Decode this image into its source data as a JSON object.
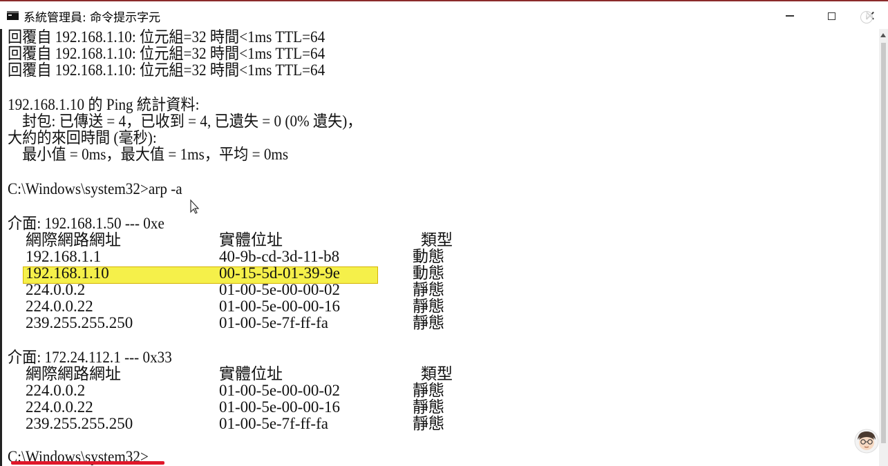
{
  "window": {
    "title": "系統管理員: 命令提示字元",
    "info_badge": "i"
  },
  "console": {
    "lines": [
      "回覆自 192.168.1.10: 位元組=32 時間<1ms TTL=64",
      "回覆自 192.168.1.10: 位元組=32 時間<1ms TTL=64",
      "回覆自 192.168.1.10: 位元組=32 時間<1ms TTL=64",
      "",
      "192.168.1.10 的 Ping 統計資料:",
      "    封包: 已傳送 = 4，已收到 = 4, 已遺失 = 0 (0% 遺失)，",
      "大約的來回時間 (毫秒):",
      "    最小值 = 0ms，最大值 = 1ms，平均 = 0ms",
      "",
      "C:\\Windows\\system32>arp -a"
    ],
    "final_prompt": "C:\\Windows\\system32>"
  },
  "arp": {
    "interfaces": [
      {
        "header": "介面: 192.168.1.50 --- 0xe",
        "columns": {
          "address": "網際網路網址",
          "physical": "實體位址",
          "type": "類型"
        },
        "rows": [
          {
            "address": "192.168.1.1",
            "physical": "40-9b-cd-3d-11-b8",
            "type": "動態",
            "highlighted": false
          },
          {
            "address": "192.168.1.10",
            "physical": "00-15-5d-01-39-9e",
            "type": "動態",
            "highlighted": true
          },
          {
            "address": "224.0.0.2",
            "physical": "01-00-5e-00-00-02",
            "type": "靜態",
            "highlighted": false
          },
          {
            "address": "224.0.0.22",
            "physical": "01-00-5e-00-00-16",
            "type": "靜態",
            "highlighted": false
          },
          {
            "address": "239.255.255.250",
            "physical": "01-00-5e-7f-ff-fa",
            "type": "靜態",
            "highlighted": false
          }
        ]
      },
      {
        "header": "介面: 172.24.112.1 --- 0x33",
        "columns": {
          "address": "網際網路網址",
          "physical": "實體位址",
          "type": "類型"
        },
        "rows": [
          {
            "address": "224.0.0.2",
            "physical": "01-00-5e-00-00-02",
            "type": "靜態",
            "highlighted": false
          },
          {
            "address": "224.0.0.22",
            "physical": "01-00-5e-00-00-16",
            "type": "靜態",
            "highlighted": false
          },
          {
            "address": "239.255.255.250",
            "physical": "01-00-5e-7f-ff-fa",
            "type": "靜態",
            "highlighted": false
          }
        ]
      }
    ]
  },
  "colors": {
    "highlight": "#f5f04a",
    "underline": "#e0182a",
    "text": "#111111"
  },
  "icons": {
    "window_icon": "terminal-icon",
    "minimize": "minimize-icon",
    "maximize": "maximize-icon",
    "close": "close-icon",
    "cursor": "mouse-pointer-icon",
    "avatar": "presenter-avatar-icon"
  }
}
